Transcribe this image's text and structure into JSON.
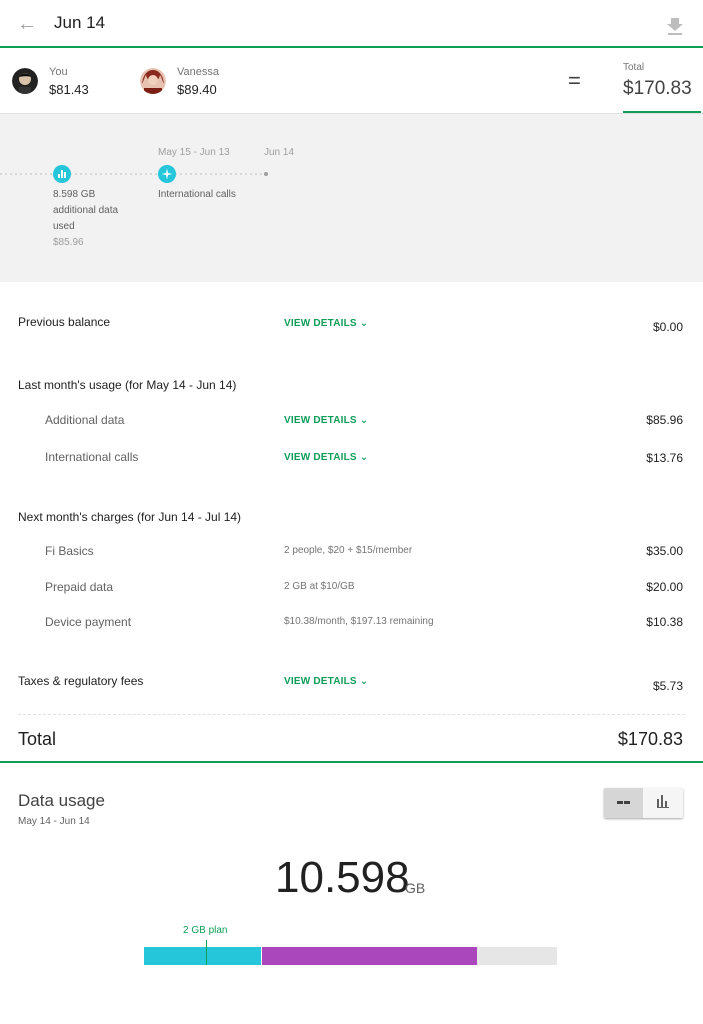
{
  "header": {
    "title": "Jun 14"
  },
  "people": [
    {
      "name": "You",
      "amount": "$81.43"
    },
    {
      "name": "Vanessa",
      "amount": "$89.40"
    }
  ],
  "summary": {
    "equals": "=",
    "total_label": "Total",
    "total_amount": "$170.83"
  },
  "timeline": {
    "period_label": "May 15 - Jun 13",
    "end_label": "Jun 14",
    "events": [
      {
        "icon": "bar-chart-icon",
        "lines": [
          "8.598 GB",
          "additional data",
          "used"
        ],
        "amount": "$85.96"
      },
      {
        "icon": "airplane-icon",
        "lines": [
          "International calls"
        ]
      }
    ]
  },
  "bill": {
    "previous_balance": {
      "label": "Previous balance",
      "link": "VIEW DETAILS",
      "amount": "$0.00"
    },
    "last_month": {
      "heading": "Last month's usage (for May 14 - Jun 14)",
      "items": [
        {
          "label": "Additional data",
          "link": "VIEW DETAILS",
          "amount": "$85.96"
        },
        {
          "label": "International calls",
          "link": "VIEW DETAILS",
          "amount": "$13.76"
        }
      ]
    },
    "next_month": {
      "heading": "Next month's charges (for Jun 14 - Jul 14)",
      "items": [
        {
          "label": "Fi Basics",
          "desc": "2 people, $20 + $15/member",
          "amount": "$35.00"
        },
        {
          "label": "Prepaid data",
          "desc": "2 GB at $10/GB",
          "amount": "$20.00"
        },
        {
          "label": "Device payment",
          "desc": "$10.38/month, $197.13 remaining",
          "amount": "$10.38"
        }
      ]
    },
    "taxes": {
      "label": "Taxes & regulatory fees",
      "link": "VIEW DETAILS",
      "amount": "$5.73"
    },
    "total": {
      "label": "Total",
      "amount": "$170.83"
    }
  },
  "data_usage": {
    "title": "Data usage",
    "range": "May 14 - Jun 14",
    "value": "10.598",
    "unit": "GB",
    "plan_label": "2 GB plan",
    "bar": {
      "prepaid_fraction": 0.283,
      "additional_fraction": 0.52
    },
    "view_modes": [
      "line-chart-icon",
      "bar-chart-icon"
    ],
    "selected_view": "line-chart-icon"
  },
  "colors": {
    "accent": "#0f9d58",
    "teal": "#26c6da",
    "purple": "#ab47bc"
  }
}
